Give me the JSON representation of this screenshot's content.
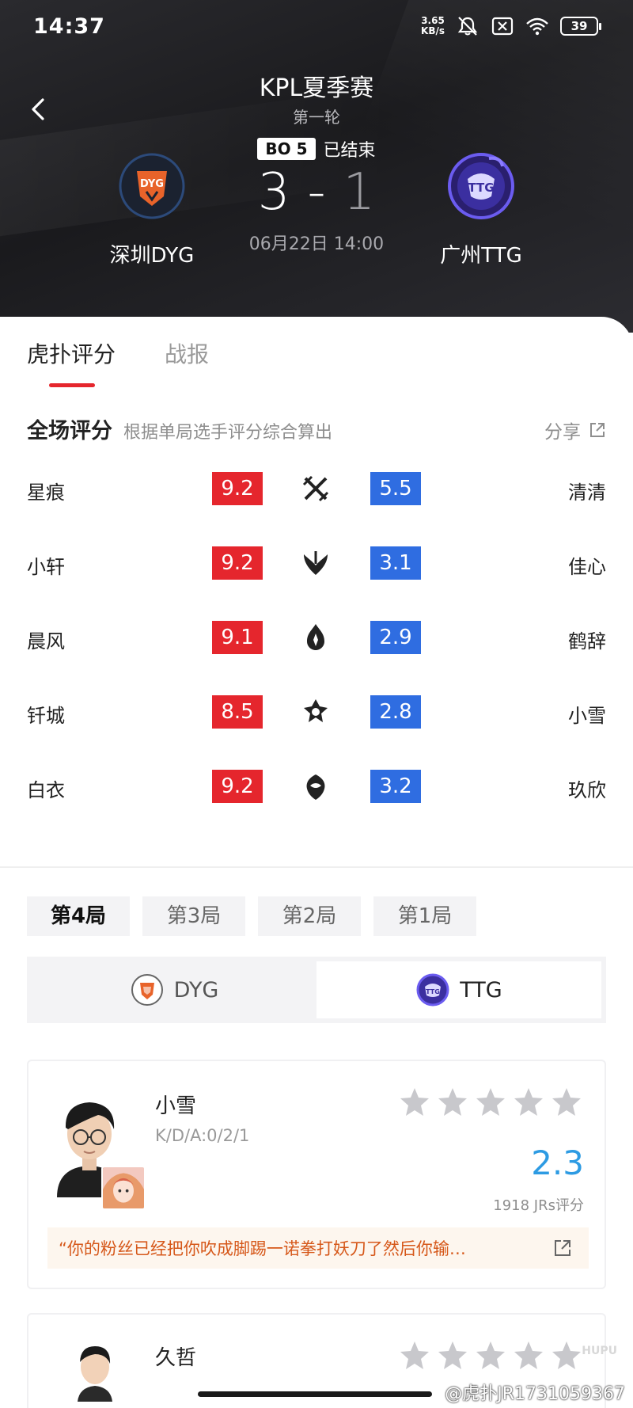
{
  "status_bar": {
    "time": "14:37",
    "net_speed_value": "3.65",
    "net_speed_unit": "KB/s",
    "battery": "39"
  },
  "match": {
    "league": "KPL夏季赛",
    "round": "第一轮",
    "bo": "BO 5",
    "status": "已结束",
    "score_left": "3",
    "score_sep": "-",
    "score_right": "1",
    "datetime": "06月22日 14:00",
    "team_left": "深圳DYG",
    "team_right": "广州TTG"
  },
  "tabs": [
    "虎扑评分",
    "战报"
  ],
  "overall": {
    "title": "全场评分",
    "subtitle": "根据单局选手评分综合算出",
    "share_label": "分享"
  },
  "ratings": [
    {
      "left_player": "星痕",
      "left_score": "9.2",
      "role_icon": "clash-lane-icon",
      "right_score": "5.5",
      "right_player": "清清"
    },
    {
      "left_player": "小轩",
      "left_score": "9.2",
      "role_icon": "jungle-icon",
      "right_score": "3.1",
      "right_player": "佳心"
    },
    {
      "left_player": "晨风",
      "left_score": "9.1",
      "role_icon": "mid-lane-icon",
      "right_score": "2.9",
      "right_player": "鹤辞"
    },
    {
      "left_player": "钎城",
      "left_score": "8.5",
      "role_icon": "farm-lane-icon",
      "right_score": "2.8",
      "right_player": "小雪"
    },
    {
      "left_player": "白衣",
      "left_score": "9.2",
      "role_icon": "roam-icon",
      "right_score": "3.2",
      "right_player": "玖欣"
    }
  ],
  "game_tabs": [
    "第4局",
    "第3局",
    "第2局",
    "第1局"
  ],
  "team_switch": {
    "left": "DYG",
    "right": "TTG",
    "selected": "TTG"
  },
  "player_card": {
    "name": "小雪",
    "kda": "K/D/A:0/2/1",
    "rating": "2.3",
    "votes": "1918 JRs评分",
    "comment": "“你的粉丝已经把你吹成脚踢一诺拳打妖刀了然后你输…"
  },
  "player_card_2": {
    "name": "久哲"
  },
  "watermark": "@虎扑JR1731059367",
  "hupu_logo": "HUPU",
  "colors": {
    "red": "#e5262d",
    "blue": "#2f6de1",
    "rating_blue": "#2d9be3",
    "comment_orange": "#d6581a"
  }
}
